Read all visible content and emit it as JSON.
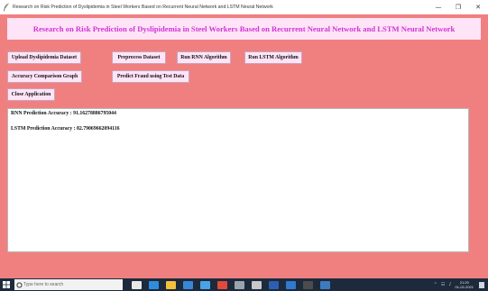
{
  "window": {
    "title": "Research on Risk Prediction of Dyslipidemia in Steel Workers Based on Recurrent Neural Network and LSTM Neural Network",
    "minimize": "—",
    "maximize": "❐",
    "close": "✕"
  },
  "page": {
    "title": "Research on Risk Prediction of Dyslipidemia in Steel Workers Based on Recurrent Neural Network and LSTM Neural Network"
  },
  "buttons": {
    "upload": "Upload Dyslipidemia Dataset",
    "preprocess": "Preprocess Dataset",
    "run_rnn": "Run RNN Algorithm",
    "run_lstm": "Run LSTM Algorithm",
    "accuracy_graph": "Accuracy Comparison Graph",
    "predict": "Predict Fraud using Test Data",
    "close_app": "Close Application"
  },
  "output": {
    "rnn_accuracy": "RNN Prediction Accuracy : 91.16278886795044",
    "lstm_accuracy": "LSTM Prediction Accuracy : 82.79069662094116"
  },
  "taskbar": {
    "search_placeholder": "Type here to search",
    "time": "21:29",
    "date": "01-02-2021",
    "icons": [
      "task-view-icon",
      "edge-icon",
      "file-explorer-icon",
      "store-icon",
      "mail-icon",
      "chrome-icon",
      "settings-icon",
      "photos-icon",
      "word-icon",
      "vscode-icon",
      "terminal-icon",
      "python-icon"
    ],
    "icon_colors": [
      "#e8e8e8",
      "#2f8de0",
      "#f2c23c",
      "#3a86d6",
      "#4aa3e8",
      "#e24a3b",
      "#9aa4ae",
      "#c8c8c8",
      "#2b5fb3",
      "#2f7ad0",
      "#4c4c4c",
      "#3d7bc0"
    ]
  },
  "colors": {
    "background": "#f08080",
    "panel": "#ffe4f7",
    "title_text": "#d033d8"
  }
}
